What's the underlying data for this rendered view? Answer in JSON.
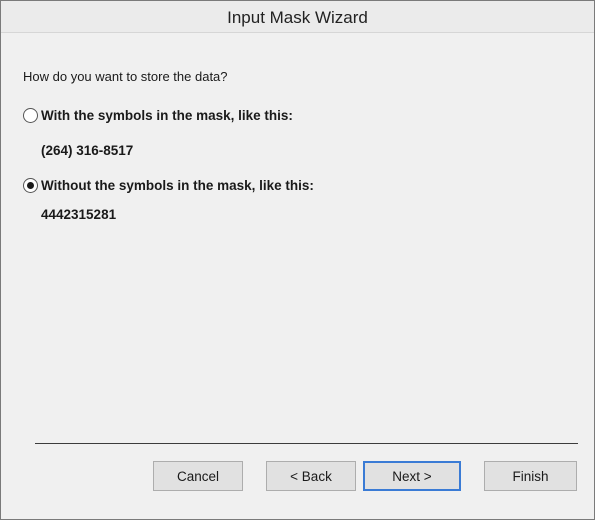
{
  "window": {
    "title": "Input Mask Wizard"
  },
  "main": {
    "question": "How do you want to store the data?",
    "options": [
      {
        "label": "With the symbols in the mask, like this:",
        "example": "(264) 316-8517",
        "checked": false
      },
      {
        "label": "Without the symbols in the mask, like this:",
        "example": "4442315281",
        "checked": true
      }
    ]
  },
  "buttons": {
    "cancel": "Cancel",
    "back": "< Back",
    "next": "Next >",
    "finish": "Finish"
  },
  "colors": {
    "default_button_border": "#3a7bd5",
    "dialog_background": "#f0f0f0"
  }
}
